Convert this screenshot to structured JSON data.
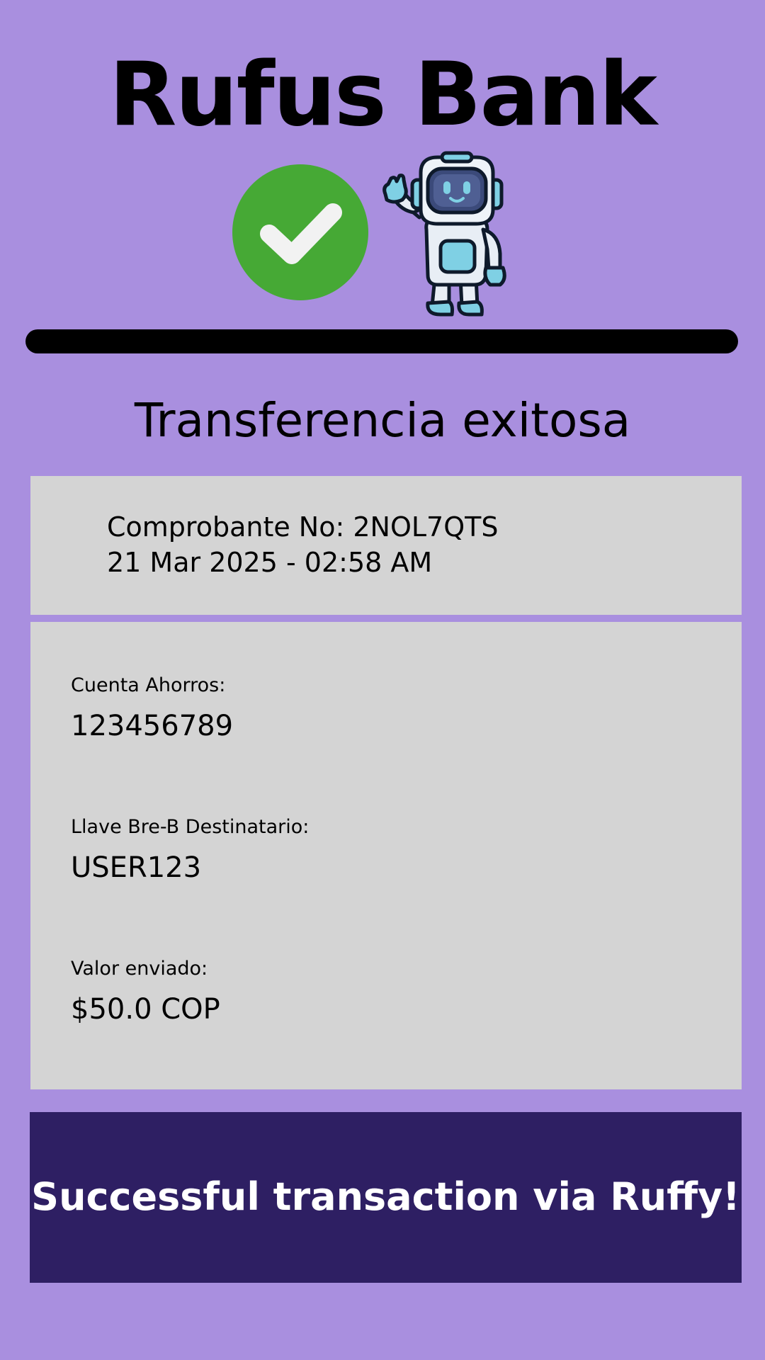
{
  "header": {
    "brand_title": "Rufus Bank",
    "success_icon": "check-circle-icon",
    "mascot_icon": "robot-astronaut-icon"
  },
  "status": {
    "title": "Transferencia exitosa"
  },
  "receipt": {
    "number_line": "Comprobante No: 2NOL7QTS",
    "datetime_line": "21 Mar 2025 - 02:58 AM"
  },
  "details": {
    "account": {
      "label": "Cuenta Ahorros:",
      "value": "123456789"
    },
    "recipient_key": {
      "label": "Llave Bre-B Destinatario:",
      "value": "USER123"
    },
    "amount": {
      "label": "Valor enviado:",
      "value": "$50.0 COP"
    }
  },
  "banner": {
    "text": "Successful transaction via Ruffy!"
  },
  "colors": {
    "background": "#a98fdf",
    "success_green": "#46a935",
    "card_gray": "#d4d4d4",
    "banner_navy": "#2e1f63",
    "banner_text": "#ffffff"
  }
}
